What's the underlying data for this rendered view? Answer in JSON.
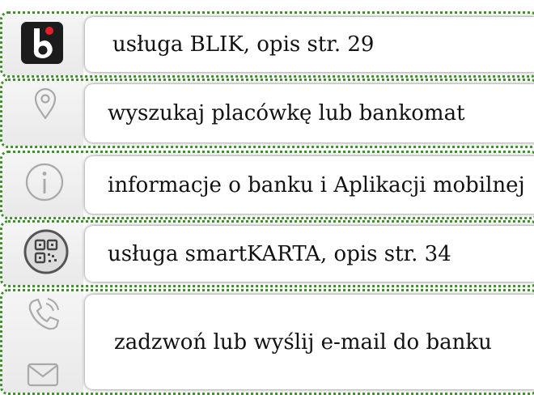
{
  "items": [
    {
      "label": "usługa BLIK, opis str. 29",
      "icon": "blik-logo-icon"
    },
    {
      "label": "wyszukaj placówkę lub bankomat",
      "icon": "location-pin-icon"
    },
    {
      "label": "informacje o banku i Aplikacji mobilnej",
      "icon": "info-icon"
    },
    {
      "label": "usługa smartKARTA, opis str. 34",
      "icon": "qr-code-icon"
    },
    {
      "label": "zadzwoń lub wyślij e-mail do banku",
      "icons": [
        "phone-icon",
        "envelope-icon"
      ]
    }
  ],
  "colors": {
    "border": "#3f8f2a",
    "icon_gray": "#a9a9a9",
    "blik_bg": "#1c1c1c",
    "blik_dot": "#e6202a"
  }
}
